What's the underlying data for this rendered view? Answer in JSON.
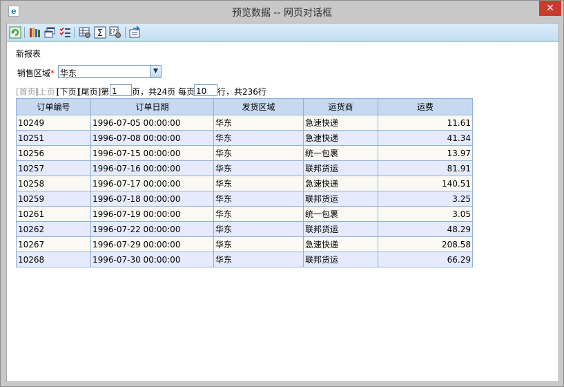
{
  "window": {
    "title": "预览数据 -- 网页对话框",
    "close_label": "✕"
  },
  "toolbar": {
    "buttons": [
      {
        "name": "refresh-icon"
      },
      {
        "name": "report-books-icon"
      },
      {
        "name": "window-cascade-icon"
      },
      {
        "name": "checklist-icon"
      },
      {
        "name": "settings-grid-icon"
      },
      {
        "name": "sum-icon"
      },
      {
        "name": "param-gear-icon"
      },
      {
        "name": "export-icon"
      }
    ]
  },
  "report": {
    "name": "新报表"
  },
  "params": {
    "region_label": "销售区域",
    "required_mark": "*",
    "region_value": "华东"
  },
  "pager": {
    "first": "[首页]",
    "prev": "[上页]",
    "next": "[下页]",
    "last": "[尾页]",
    "page_prefix": "第",
    "page_value": "1",
    "page_suffix": "页，共24页 每页",
    "page_size_value": "10",
    "rows_suffix": "行，共236行"
  },
  "table": {
    "columns": [
      "订单编号",
      "订单日期",
      "发货区域",
      "运货商",
      "运费"
    ],
    "rows": [
      [
        "10249",
        "1996-07-05 00:00:00",
        "华东",
        "急速快递",
        "11.61"
      ],
      [
        "10251",
        "1996-07-08 00:00:00",
        "华东",
        "急速快递",
        "41.34"
      ],
      [
        "10256",
        "1996-07-15 00:00:00",
        "华东",
        "统一包裹",
        "13.97"
      ],
      [
        "10257",
        "1996-07-16 00:00:00",
        "华东",
        "联邦货运",
        "81.91"
      ],
      [
        "10258",
        "1996-07-17 00:00:00",
        "华东",
        "急速快递",
        "140.51"
      ],
      [
        "10259",
        "1996-07-18 00:00:00",
        "华东",
        "联邦货运",
        "3.25"
      ],
      [
        "10261",
        "1996-07-19 00:00:00",
        "华东",
        "统一包裹",
        "3.05"
      ],
      [
        "10262",
        "1996-07-22 00:00:00",
        "华东",
        "联邦货运",
        "48.29"
      ],
      [
        "10267",
        "1996-07-29 00:00:00",
        "华东",
        "急速快递",
        "208.58"
      ],
      [
        "10268",
        "1996-07-30 00:00:00",
        "华东",
        "联邦货运",
        "66.29"
      ]
    ]
  }
}
